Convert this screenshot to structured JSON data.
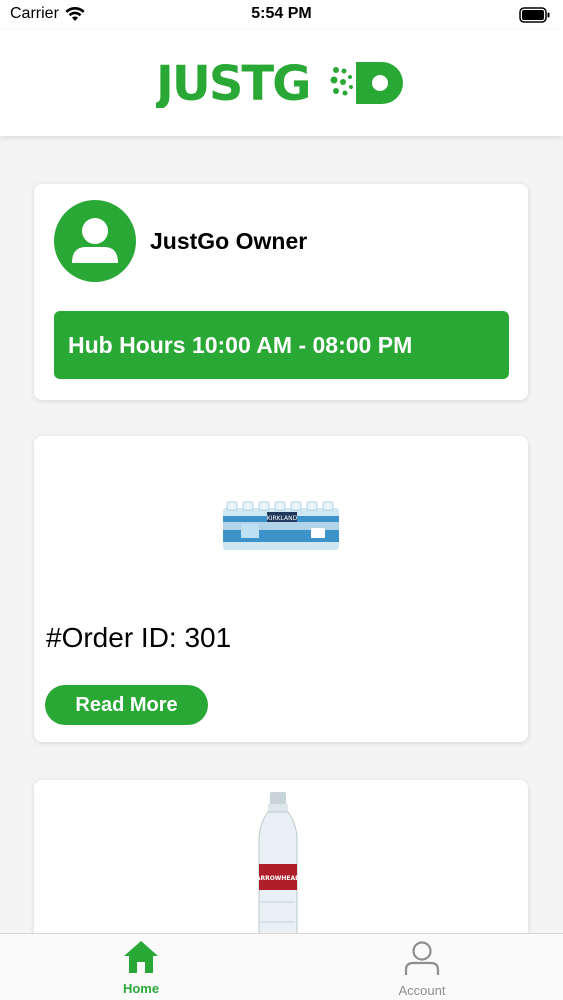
{
  "status_bar": {
    "carrier": "Carrier",
    "time": "5:54 PM"
  },
  "header": {
    "logo_text": "JUSTGO"
  },
  "owner_card": {
    "name": "JustGo Owner",
    "hub_hours": "Hub Hours 10:00 AM - 08:00 PM"
  },
  "orders": [
    {
      "order_id": "#Order ID: 301",
      "read_more_label": "Read More",
      "product_brand": "KIRKLAND"
    },
    {
      "product_brand": "ARROWHEAD"
    }
  ],
  "tab_bar": {
    "tabs": [
      {
        "label": "Home",
        "active": true
      },
      {
        "label": "Account",
        "active": false
      }
    ]
  },
  "colors": {
    "brand_green": "#2aa836"
  }
}
